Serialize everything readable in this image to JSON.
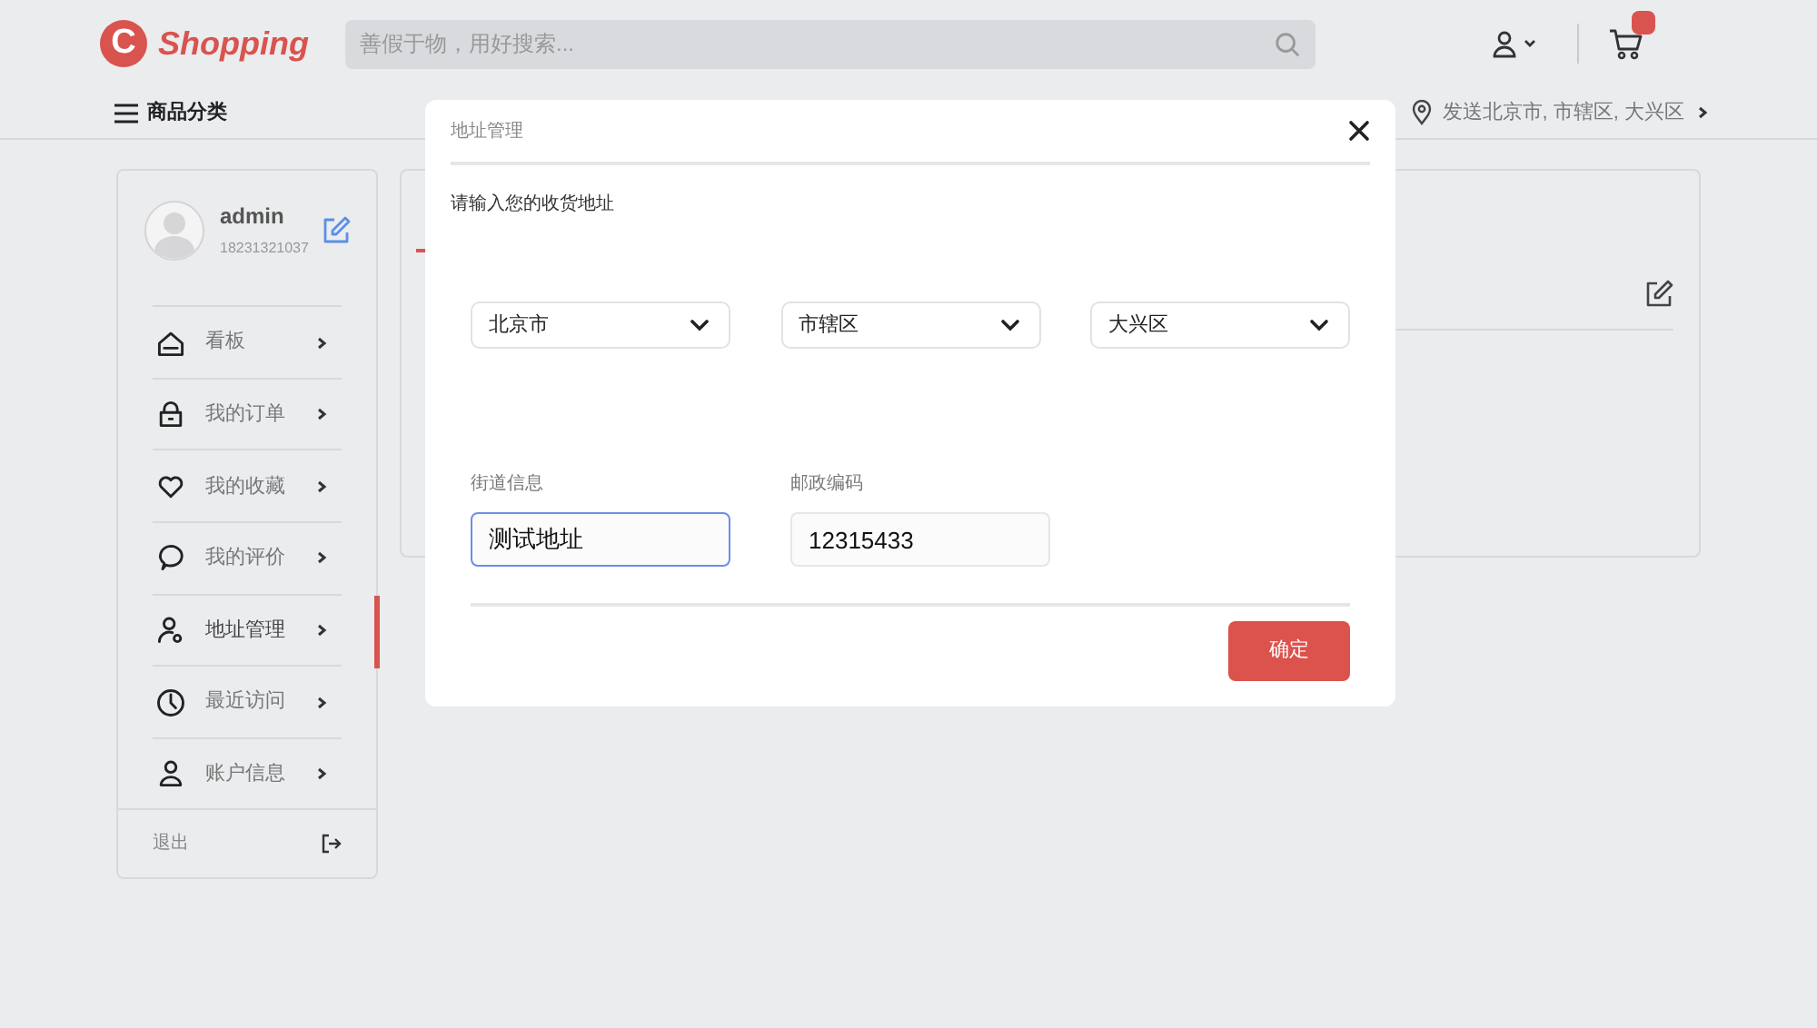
{
  "header": {
    "logo_letter": "C",
    "logo_text": "Shopping",
    "search": {
      "placeholder": "善假于物，用好搜索..."
    }
  },
  "nav": {
    "categories": "商品分类",
    "delivery": "发送北京市, 市辖区, 大兴区"
  },
  "profile": {
    "name": "admin",
    "phone": "18231321037"
  },
  "sidebar": {
    "items": [
      {
        "label": "看板",
        "selected": false
      },
      {
        "label": "我的订单",
        "selected": false
      },
      {
        "label": "我的收藏",
        "selected": false
      },
      {
        "label": "我的评价",
        "selected": false
      },
      {
        "label": "地址管理",
        "selected": true
      },
      {
        "label": "最近访问",
        "selected": false
      },
      {
        "label": "账户信息",
        "selected": false
      }
    ],
    "logout": "退出"
  },
  "dialog": {
    "title": "地址管理",
    "prompt": "请输入您的收货地址",
    "selects": [
      {
        "value": "北京市"
      },
      {
        "value": "市辖区"
      },
      {
        "value": "大兴区"
      }
    ],
    "fields": [
      {
        "label": "街道信息",
        "value": "测试地址",
        "focused": true
      },
      {
        "label": "邮政编码",
        "value": "12315433",
        "focused": false
      }
    ],
    "confirm": "确定"
  }
}
